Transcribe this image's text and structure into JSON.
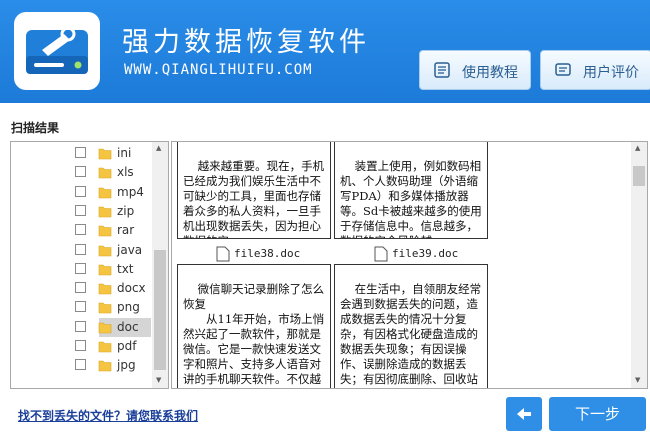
{
  "header": {
    "title": "强力数据恢复软件",
    "url": "WWW.QIANGLIHUIFU.COM",
    "tutorial_label": "使用教程",
    "review_label": "用户评价"
  },
  "scan": {
    "section_label": "扫描结果"
  },
  "tree": {
    "items": [
      {
        "label": "ini"
      },
      {
        "label": "xls"
      },
      {
        "label": "mp4"
      },
      {
        "label": "zip"
      },
      {
        "label": "rar"
      },
      {
        "label": "java"
      },
      {
        "label": "txt"
      },
      {
        "label": "docx"
      },
      {
        "label": "png"
      },
      {
        "label": "doc"
      },
      {
        "label": "pdf"
      },
      {
        "label": "jpg"
      }
    ],
    "selected": "doc"
  },
  "previews": [
    {
      "text": "越来越重要。现在，手机已经成为我们娱乐生活中不可缺少的工具，里面也存储着众多的私人资料，一旦手机出现数据丢失，因为担心数据的安",
      "filename": "file38.doc"
    },
    {
      "text": "装置上使用，例如数码相机、个人数码助理（外语缩写PDA）和多媒体播放器等。Sd卡被越来越多的使用于存储信息中。信息越多，数据的安全风险越",
      "filename": "file39.doc"
    },
    {
      "text": "微信聊天记录删除了怎么恢复\n　　从11年开始，市场上悄然兴起了一款软件，那就是微信。它是一款快速发送文字和照片、支持多人语音对讲的手机聊天软件。不仅越来越受到年轻人的",
      "filename": ""
    },
    {
      "text": "在生活中，自领朋友经常会遇到数据丢失的问题，造成数据丢失的情况十分复杂，有因格式化硬盘造成的数据丢失现象；有因误操作、误删除造成的数据丢失；有因彻底删除、回收站",
      "filename": ""
    }
  ],
  "footer": {
    "help_link": "找不到丢失的文件？请您联系我们",
    "next_label": "下一步"
  },
  "colors": {
    "header_blue": "#1d7ad8",
    "button_blue": "#2f8fe6",
    "folder_yellow": "#f5c542",
    "link_blue": "#1a3f9a"
  }
}
